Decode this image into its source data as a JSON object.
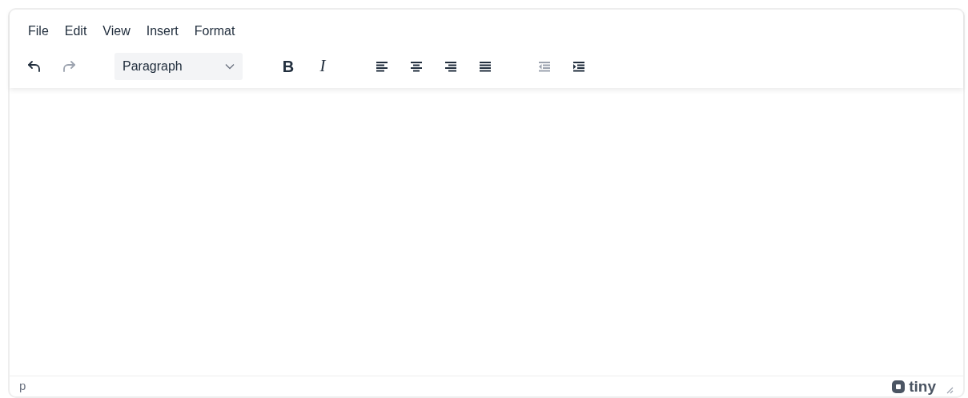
{
  "menu_bar": [
    "File",
    "Edit",
    "View",
    "Insert",
    "Format"
  ],
  "toolbar": {
    "groups": [
      [
        {
          "kind": "undo",
          "disabled": false
        },
        {
          "kind": "redo",
          "disabled": true
        }
      ],
      [
        {
          "kind": "dropdown",
          "value": "Paragraph"
        }
      ],
      [
        {
          "kind": "bold",
          "label": "B"
        },
        {
          "kind": "italic",
          "label": "I"
        }
      ],
      [
        {
          "kind": "align-left"
        },
        {
          "kind": "align-center"
        },
        {
          "kind": "align-right"
        },
        {
          "kind": "justify"
        }
      ],
      [
        {
          "kind": "outdent",
          "disabled": true
        },
        {
          "kind": "indent",
          "disabled": false
        }
      ]
    ]
  },
  "status_bar": {
    "path": "p",
    "brand": "tiny"
  }
}
